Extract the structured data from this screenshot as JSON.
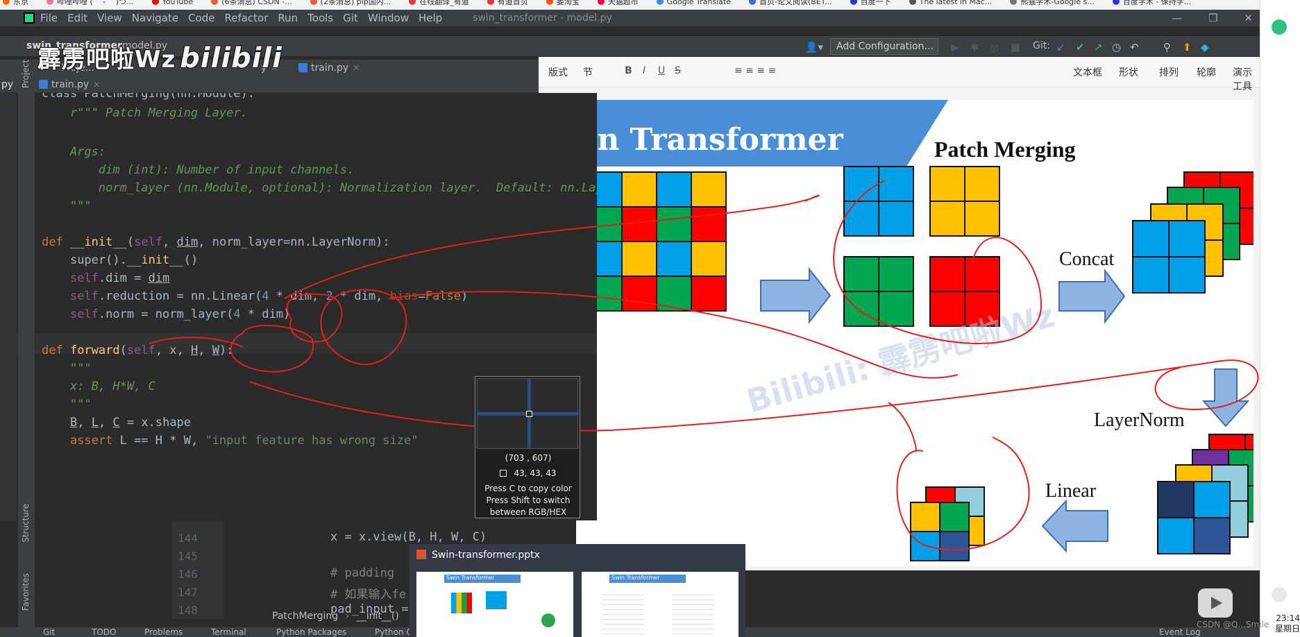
{
  "bookmarks": [
    "东京",
    "哔哩哔哩 ( ゜- ゜)つ...",
    "YouTube",
    "(6条消息) CSDN -...",
    "(2条消息) pip国内...",
    "在线翻译_有道",
    "有道首页",
    "姜淘宝",
    "天猫超市",
    "Google Translate",
    "首页-论文阅读(BET...",
    "百度一下",
    "The latest in Mac...",
    "熊猫学术-Google s...",
    "百度学术 - 保持学..."
  ],
  "ide": {
    "menu": [
      "File",
      "Edit",
      "View",
      "Navigate",
      "Code",
      "Refactor",
      "Run",
      "Tools",
      "Git",
      "Window",
      "Help"
    ],
    "window_title": "swin_transformer - model.py",
    "project_name": "swin_transformer",
    "file_crumb": "model.py",
    "run_config": "Add Configuration...",
    "git_label": "Git:",
    "tabs_upper": [
      "Proje...",
      "y",
      "train.py"
    ],
    "tabs_lower": [
      "py",
      "train.py"
    ],
    "side_labels": [
      "Project",
      "Structure",
      "Favorites"
    ],
    "code": {
      "l0": "class PatchMerging(nn.Module):",
      "l1": "    r\"\"\" Patch Merging Layer.",
      "l3": "    Args:",
      "l4": "        dim (int): Number of input channels.",
      "l5": "        norm_layer (nn.Module, optional): Normalization layer.  Default: nn.LayerNorm",
      "l6": "    \"\"\"",
      "l11": "self.reduction",
      "l15": "\"\"\"",
      "l16": "x: B, H*W, C",
      "l17": "\"\"\"",
      "l19_str": "\"input feature has wrong size\""
    },
    "bg_lines": [
      {
        "num": "144",
        "text": "x = x.view(B, H, W, C)"
      },
      {
        "num": "145",
        "text": ""
      },
      {
        "num": "146",
        "text": "# padding"
      },
      {
        "num": "147",
        "text": "# 如果输入fe"
      },
      {
        "num": "148",
        "text": "pad_input ="
      }
    ],
    "breadcrumb": [
      "PatchMerging",
      "__init__()"
    ],
    "status_items": [
      "Git",
      "TODO",
      "Problems",
      "Terminal",
      "Python Packages",
      "Python C",
      "Event Log"
    ]
  },
  "watermark": "霹雳吧啦Wz",
  "watermark_logo": "bilibili",
  "picker": {
    "coords": "(703 , 607)",
    "rgb": "43,  43,  43",
    "line1": "Press C to copy color",
    "line2": "Press Shift to switch",
    "line3": "between RGB/HEX"
  },
  "ppt": {
    "ribbon": [
      "版式",
      "节",
      "文本框",
      "形状",
      "排列",
      "轮廓",
      "演示工具"
    ],
    "slide_title": "Swin Transformer",
    "slide_subtitle": "Patch Merging",
    "concat": "Concat",
    "layernorm": "LayerNorm",
    "linear": "Linear",
    "watermark": "Bilibili: 霹雳吧啦Wz",
    "taskbar_title": "Swin-transformer.pptx",
    "thumb1_title": "Swin Transformer",
    "thumb2_title": "Swin Transformer"
  },
  "colors": {
    "blue": "#00a0e9",
    "yellow": "#ffc000",
    "green": "#00a650",
    "red": "#ff0000"
  },
  "clock": {
    "time": "23:14",
    "day": "星期日"
  },
  "csdn_mark": "CSDN @Q...Smile"
}
